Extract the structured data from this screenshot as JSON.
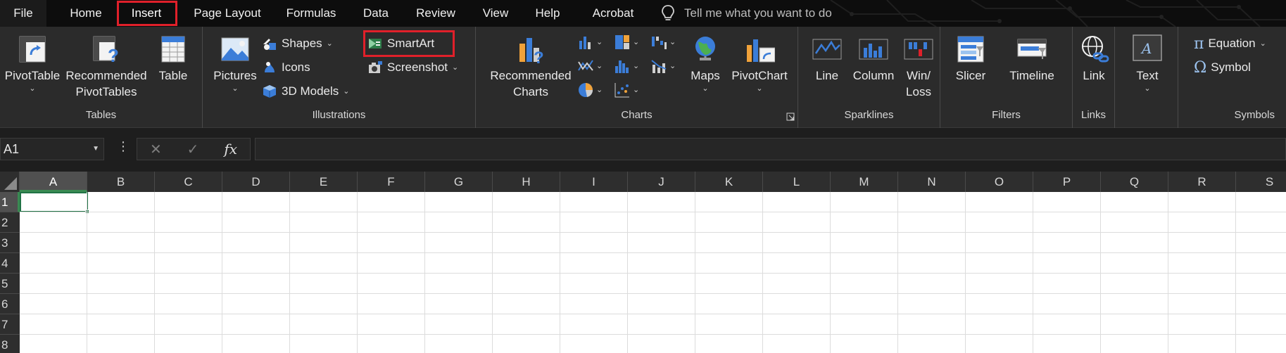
{
  "menu": {
    "tabs": [
      "File",
      "Home",
      "Insert",
      "Page Layout",
      "Formulas",
      "Data",
      "Review",
      "View",
      "Help",
      "Acrobat"
    ],
    "active_tab": "Insert",
    "tell_me_placeholder": "Tell me what you want to do"
  },
  "ribbon": {
    "tables": {
      "label": "Tables",
      "pivottable": "PivotTable",
      "recommended_line1": "Recommended",
      "recommended_line2": "PivotTables",
      "table": "Table"
    },
    "illustrations": {
      "label": "Illustrations",
      "pictures": "Pictures",
      "shapes": "Shapes",
      "icons": "Icons",
      "models": "3D Models",
      "smartart": "SmartArt",
      "screenshot": "Screenshot"
    },
    "charts": {
      "label": "Charts",
      "recommended_line1": "Recommended",
      "recommended_line2": "Charts",
      "maps": "Maps",
      "pivotchart": "PivotChart"
    },
    "sparklines": {
      "label": "Sparklines",
      "line": "Line",
      "column": "Column",
      "winloss_line1": "Win/",
      "winloss_line2": "Loss"
    },
    "filters": {
      "label": "Filters",
      "slicer": "Slicer",
      "timeline": "Timeline"
    },
    "links": {
      "label": "Links",
      "link": "Link"
    },
    "text": {
      "text": "Text"
    },
    "symbols": {
      "label": "Symbols",
      "equation": "Equation",
      "symbol": "Symbol"
    }
  },
  "formula_bar": {
    "name_box": "A1",
    "fx": "fx",
    "cancel": "✕",
    "enter": "✓",
    "value": ""
  },
  "sheet": {
    "columns": [
      "A",
      "B",
      "C",
      "D",
      "E",
      "F",
      "G",
      "H",
      "I",
      "J",
      "K",
      "L",
      "M",
      "N",
      "O",
      "P",
      "Q",
      "R",
      "S"
    ],
    "rows": [
      "1",
      "2",
      "3",
      "4",
      "5",
      "6",
      "7",
      "8"
    ],
    "selected_cell": "A1"
  },
  "colors": {
    "highlight_box": "#e0202a",
    "selection_green": "#217346",
    "ribbon_bg": "#2b2b2b"
  }
}
